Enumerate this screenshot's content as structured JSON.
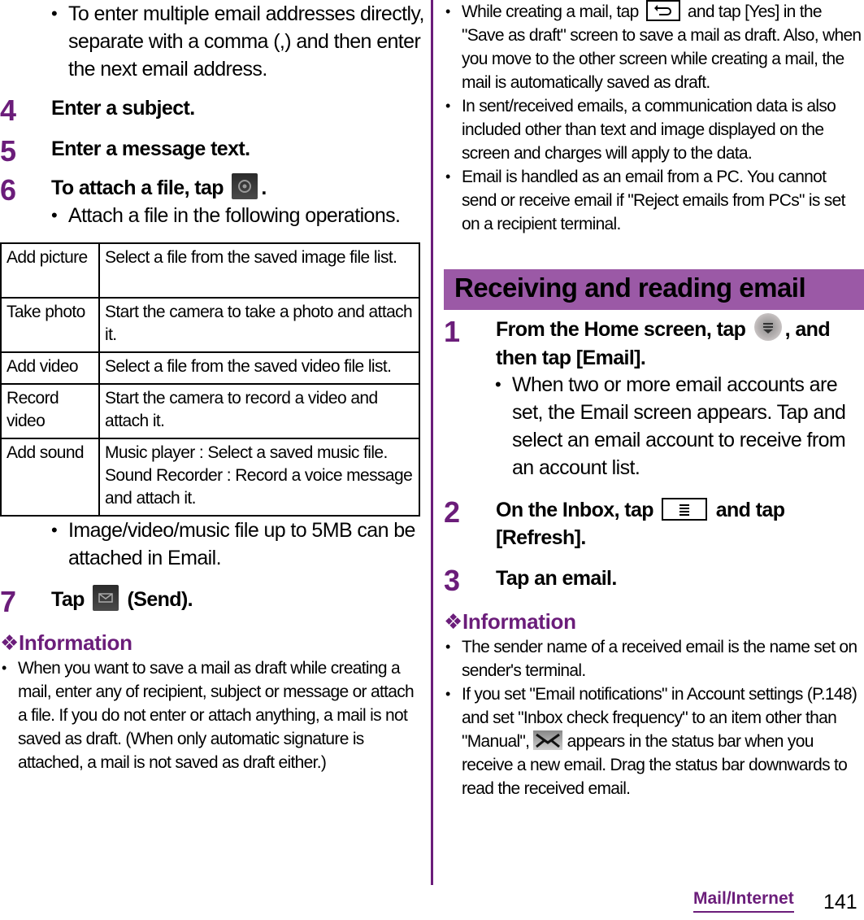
{
  "left": {
    "intro_bullet": "To enter multiple email addresses directly, separate with a comma (,) and then enter the next email address.",
    "steps": [
      {
        "num": "4",
        "text": "Enter a subject."
      },
      {
        "num": "5",
        "text": "Enter a message text."
      },
      {
        "num": "6",
        "text_before": "To attach a file, tap",
        "text_after": ".",
        "icon": "attach-icon"
      }
    ],
    "attach_note": "Attach a file in the following operations.",
    "table": [
      {
        "key": "Add picture",
        "value": "Select a file from the saved image file list."
      },
      {
        "key": "Take photo",
        "value": "Start the camera to take a photo and attach it."
      },
      {
        "key": "Add video",
        "value": "Select a file from the saved video file list."
      },
      {
        "key": "Record video",
        "value": "Start the camera to record a video and attach it."
      },
      {
        "key": "Add sound",
        "music_label": "Music player",
        "music_text": " : Select a saved music file.",
        "recorder_label": "Sound Recorder",
        "recorder_text": " : Record a voice message and attach it."
      }
    ],
    "size_note": "Image/video/music file up to 5MB can be attached in Email.",
    "step7": {
      "num": "7",
      "text_before": "Tap",
      "text_after": "(Send).",
      "icon": "send-icon"
    },
    "info_title": "❖Information",
    "info_items": [
      "When you want to save a mail as draft while creating a mail, enter any of recipient, subject or message or attach a file. If you do not enter or attach anything, a mail is not saved as draft. (When only automatic signature is attached, a mail is not saved as draft either.)"
    ]
  },
  "right": {
    "top_items": [
      {
        "before": "While creating a mail, tap",
        "after": "and tap [Yes] in the \"Save as draft\" screen to save a mail as draft. Also, when you move to the other screen while creating a mail, the mail is automatically saved as draft.",
        "icon": "back-key-icon"
      },
      {
        "text": "In sent/received emails, a communication data is also included other than text and image displayed on the screen and charges will apply to the data."
      },
      {
        "text": "Email is handled as an email from a PC. You cannot send or receive email if \"Reject emails from PCs\" is set on a recipient terminal."
      }
    ],
    "section_title": "Receiving and reading email",
    "steps": [
      {
        "num": "1",
        "text_before": "From the Home screen, tap",
        "text_after": ", and then tap [Email].",
        "icon": "app-drawer-icon",
        "note": "When two or more email accounts are set, the Email screen appears. Tap and select an email account to receive from an account list."
      },
      {
        "num": "2",
        "text_before": "On the Inbox, tap",
        "text_after": "and tap [Refresh].",
        "icon": "menu-key-icon"
      },
      {
        "num": "3",
        "text": "Tap an email."
      }
    ],
    "info_title": "❖Information",
    "info_items": [
      {
        "text": "The sender name of a received email is the name set on sender's terminal."
      },
      {
        "before": "If you set \"Email notifications\" in Account settings (P.148) and set \"Inbox check frequency\" to an item other than \"Manual\",",
        "after": "appears in the status bar when you receive a new email. Drag the status bar downwards to read the received email.",
        "icon": "new-email-status-icon"
      }
    ]
  },
  "footer": {
    "section": "Mail/Internet",
    "page": "141"
  },
  "colors": {
    "accent": "#6b1d7a",
    "section_bar": "#9b59a6"
  }
}
